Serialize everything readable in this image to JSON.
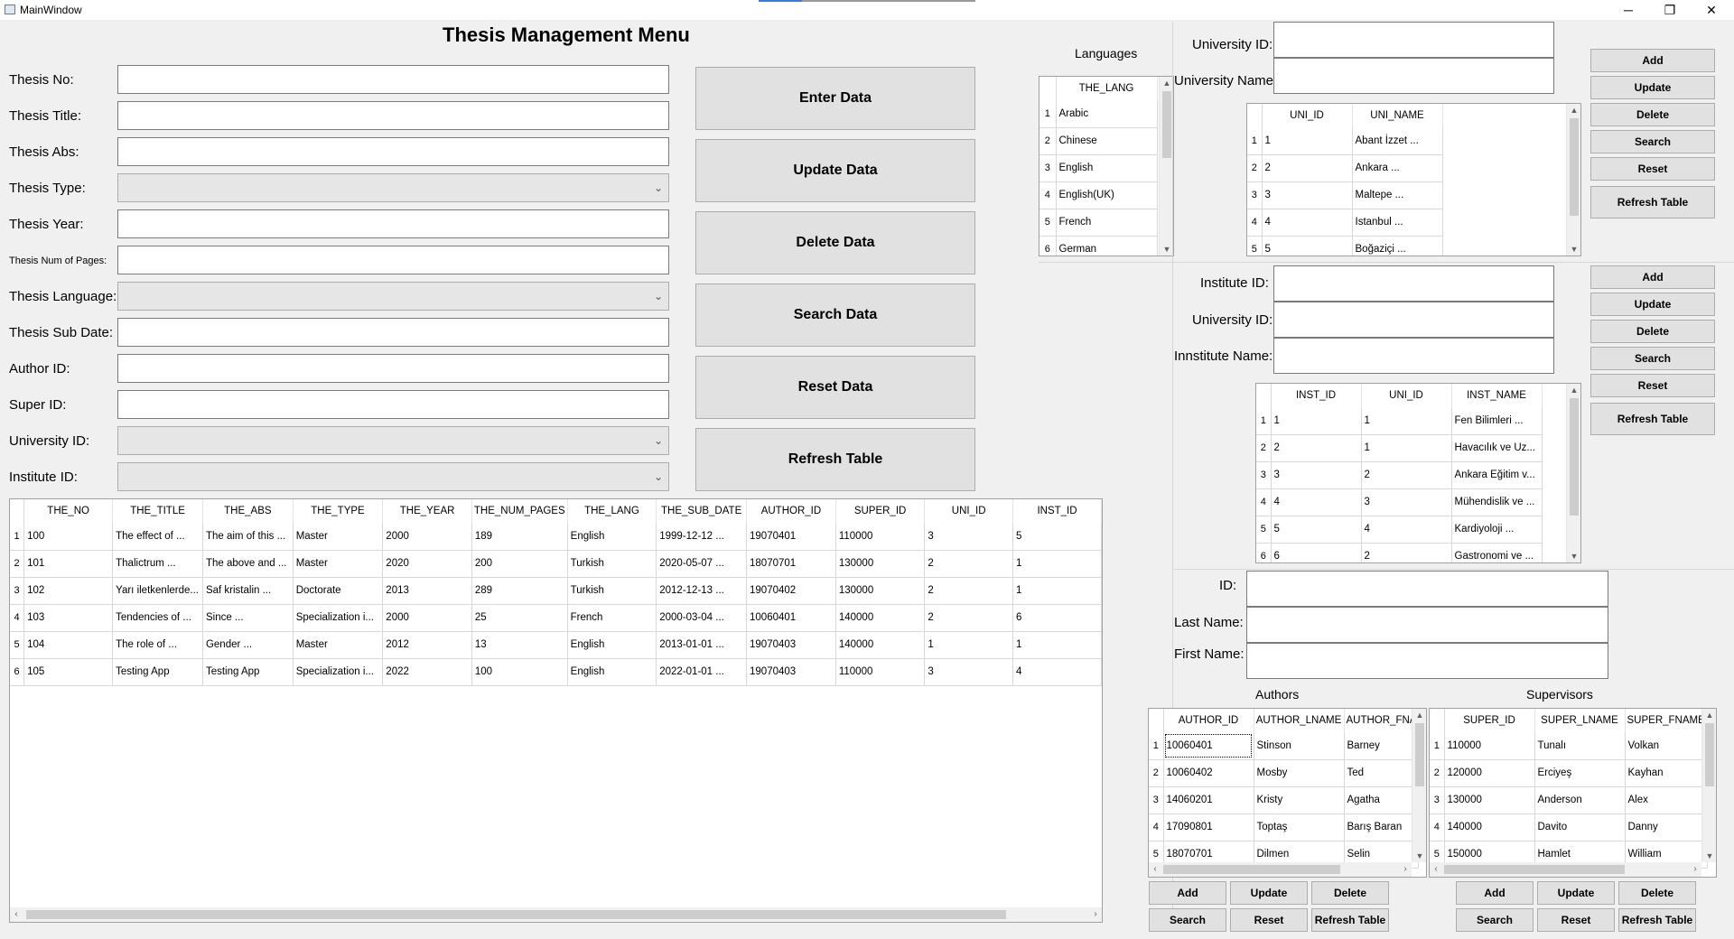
{
  "window": {
    "title": "MainWindow",
    "minimize": "─",
    "maximize": "❐",
    "close": "✕"
  },
  "main_title": "Thesis Management Menu",
  "form": {
    "thesis_no": "Thesis No:",
    "thesis_title": "Thesis Title:",
    "thesis_abs": "Thesis Abs:",
    "thesis_type": "Thesis Type:",
    "thesis_year": "Thesis Year:",
    "thesis_num_pages": "Thesis Num of Pages:",
    "thesis_language": "Thesis Language:",
    "thesis_sub_date": "Thesis Sub Date:",
    "author_id": "Author ID:",
    "super_id": "Super ID:",
    "university_id": "University ID:",
    "institute_id": "Institute ID:"
  },
  "actions": {
    "enter": "Enter Data",
    "update": "Update Data",
    "delete": "Delete Data",
    "search": "Search Data",
    "reset": "Reset Data",
    "refresh": "Refresh Table"
  },
  "thesis_table": {
    "columns": [
      "THE_NO",
      "THE_TITLE",
      "THE_ABS",
      "THE_TYPE",
      "THE_YEAR",
      "THE_NUM_PAGES",
      "THE_LANG",
      "THE_SUB_DATE",
      "AUTHOR_ID",
      "SUPER_ID",
      "UNI_ID",
      "INST_ID"
    ],
    "rows": [
      [
        "100",
        "The effect of ...",
        "The aim of this ...",
        "Master",
        "2000",
        "189",
        "English",
        "1999-12-12 ...",
        "19070401",
        "110000",
        "3",
        "5"
      ],
      [
        "101",
        "Thalictrum ...",
        "The above and ...",
        "Master",
        "2020",
        "200",
        "Turkish",
        "2020-05-07 ...",
        "18070701",
        "130000",
        "2",
        "1"
      ],
      [
        "102",
        "Yarı iletkenlerde...",
        "Saf kristalin ...",
        "Doctorate",
        "2013",
        "289",
        "Turkish",
        "2012-12-13 ...",
        "19070402",
        "130000",
        "2",
        "1"
      ],
      [
        "103",
        "Tendencies of ...",
        "Since ...",
        "Specialization i...",
        "2000",
        "25",
        "French",
        "2000-03-04 ...",
        "10060401",
        "140000",
        "2",
        "6"
      ],
      [
        "104",
        "The role of ...",
        " Gender ...",
        "Master",
        "2012",
        "13",
        "English",
        "2013-01-01 ...",
        "19070403",
        "140000",
        "1",
        "1"
      ],
      [
        "105",
        "Testing App",
        "Testing App",
        "Specialization i...",
        "2022",
        "100",
        "English",
        "2022-01-01 ...",
        "19070403",
        "110000",
        "3",
        "4"
      ]
    ],
    "row_numbers": [
      "1",
      "2",
      "3",
      "4",
      "5",
      "6"
    ]
  },
  "languages": {
    "title": "Languages",
    "column": "THE_LANG",
    "rows": [
      "Arabic",
      "Chinese",
      "English",
      "English(UK)",
      "French",
      "German"
    ],
    "row_numbers": [
      "1",
      "2",
      "3",
      "4",
      "5",
      "6"
    ]
  },
  "university": {
    "id_label": "University ID:",
    "name_label": "University Name:",
    "columns": [
      "UNI_ID",
      "UNI_NAME"
    ],
    "rows": [
      [
        "1",
        "Abant İzzet ..."
      ],
      [
        "2",
        "Ankara ..."
      ],
      [
        "3",
        "Maltepe ..."
      ],
      [
        "4",
        "Istanbul ..."
      ],
      [
        "5",
        "Boğaziçi ..."
      ]
    ],
    "row_numbers": [
      "1",
      "2",
      "3",
      "4",
      "5"
    ],
    "buttons": {
      "add": "Add",
      "update": "Update",
      "delete": "Delete",
      "search": "Search",
      "reset": "Reset",
      "refresh": "Refresh Table"
    }
  },
  "institute": {
    "id_label": "Institute ID:",
    "uni_label": "University ID:",
    "name_label": "Innstitute Name:",
    "columns": [
      "INST_ID",
      "UNI_ID",
      "INST_NAME"
    ],
    "rows": [
      [
        "1",
        "1",
        "Fen Bilimleri ..."
      ],
      [
        "2",
        "1",
        "Havacılık ve Uz..."
      ],
      [
        "3",
        "2",
        "Ankara Eğitim v..."
      ],
      [
        "4",
        "3",
        "Mühendislik ve ..."
      ],
      [
        "5",
        "4",
        "Kardiyoloji ..."
      ],
      [
        "6",
        "2",
        "Gastronomi ve ..."
      ]
    ],
    "row_numbers": [
      "1",
      "2",
      "3",
      "4",
      "5",
      "6"
    ],
    "buttons": {
      "add": "Add",
      "update": "Update",
      "delete": "Delete",
      "search": "Search",
      "reset": "Reset",
      "refresh": "Refresh Table"
    }
  },
  "person": {
    "id_label": "ID:",
    "last_label": "Last Name:",
    "first_label": "First Name:"
  },
  "authors": {
    "title": "Authors",
    "columns": [
      "AUTHOR_ID",
      "AUTHOR_LNAME",
      "AUTHOR_FNA"
    ],
    "rows": [
      [
        "10060401",
        "Stinson",
        "Barney"
      ],
      [
        "10060402",
        "Mosby",
        "Ted"
      ],
      [
        "14060201",
        "Kristy",
        "Agatha"
      ],
      [
        "17090801",
        "Toptaş",
        "Barış Baran"
      ],
      [
        "18070701",
        "Dilmen",
        "Selin"
      ]
    ],
    "row_numbers": [
      "1",
      "2",
      "3",
      "4",
      "5"
    ],
    "buttons": {
      "add": "Add",
      "update": "Update",
      "delete": "Delete",
      "search": "Search",
      "reset": "Reset",
      "refresh": "Refresh Table"
    }
  },
  "supervisors": {
    "title": "Supervisors",
    "columns": [
      "SUPER_ID",
      "SUPER_LNAME",
      "SUPER_FNAME"
    ],
    "rows": [
      [
        "110000",
        "Tunalı",
        "Volkan"
      ],
      [
        "120000",
        "Erciyeş",
        "Kayhan"
      ],
      [
        "130000",
        "Anderson",
        "Alex"
      ],
      [
        "140000",
        "Davito",
        "Danny"
      ],
      [
        "150000",
        "Hamlet",
        "William"
      ]
    ],
    "row_numbers": [
      "1",
      "2",
      "3",
      "4",
      "5"
    ],
    "buttons": {
      "add": "Add",
      "update": "Update",
      "delete": "Delete",
      "search": "Search",
      "reset": "Reset",
      "refresh": "Refresh Table"
    }
  }
}
